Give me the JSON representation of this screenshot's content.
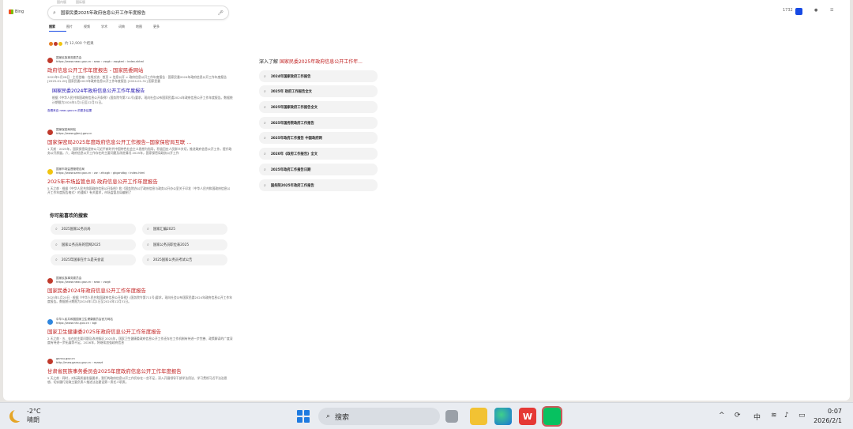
{
  "browser": {
    "top_tabs": [
      "国内版",
      "国际版"
    ],
    "logo_text": "Bing",
    "query": "国家民委2025年政府信息公开工作年度报告",
    "points": "1732",
    "tabs": [
      "搜索",
      "图片",
      "视频",
      "学术",
      "词典",
      "地图",
      "更多"
    ],
    "result_count": "约 12,900 个结果"
  },
  "results": [
    {
      "site_name": "国家民族事务委员会",
      "url": "https://www.neac.gov.cn › seac › zwgk › zwgkml › index.shtml",
      "title": "政府信息公开工作年度报告 - 国家民委网站",
      "snippet": "2022年1月28日 · 主任信箱 · 在线交流 · 首页 > 信息公开 > 政府信息公开工作年度报告 · 国家民委2024年政府信息公开工作年度报告 [2025-01-20] 国家民委2023年政府信息公开工作年度报告 [2024-01-31] 国家民委",
      "sub_title": "国家民委2024年政府信息公开工作年度报告",
      "sub_snippet": "根据《中华人民共和国政府信息公开条例》(国务院令第711号)要求，现向社会公布国家民委2024年政府信息公开工作年度报告。数据统计期限为2024年1月1日至12月31日。",
      "more": "查看来自 neac.gov.cn 的更多结果",
      "fav": "#c0392b"
    },
    {
      "site_name": "国家保密局网站",
      "url": "https://www.gjbmj.gov.cn",
      "title": "国家保密局2025年度政府信息公开工作报告--国家保密局互联 ...",
      "snippet": "1 天前 · 2025年，国家保密局坚持以习近平新时代中国特色社会主义思想为指导，积极回应人民群众关切，推进政府信息公开工作，提升政务公开质量。六、政府信息公开工作存在的主要问题及改进情况 2025年，国家保密局政务公开工作",
      "fav": "#c0392b"
    },
    {
      "site_name": "国家市场监督管理总局",
      "url": "https://www.samr.gov.cn › zw › zfxxgk › gkgzndbg › index.html",
      "title": "2025年市场监管总局 政府信息公开工作年度报告",
      "snippet": "5 天之前 · 根据《中华人民共和国政府信息公开条例》和《国务院办公厅政府信息与政务公开办公室关于印发〈中华人民共和国政府信息公开工作年度报告格式〉的通知》有关要求，市场监管总局编制了",
      "fav": "#f1c40f"
    }
  ],
  "also_search": {
    "heading": "你可能喜欢的搜索",
    "items": [
      "2025国家公务员局",
      "国家公务员局的官网2025",
      "2025年国家在什么是天会议",
      "国家汇编2025",
      "国家公务员职位表2025",
      "2025国家公务员考试公告"
    ]
  },
  "results2": [
    {
      "site_name": "国家民族事务委员会",
      "url": "https://www.neac.gov.cn › seac › zwgk",
      "title": "国家民委2024年政府信息公开工作年度报告",
      "snippet": "2025年1月20日 · 根据《中华人民共和国政府信息公开条例》(国务院令第711号)要求，现向社会公布国家民委2024年政府信息公开工作年度报告。数据统计期限为2024年1月1日至2024年12月31日。",
      "fav": "#c0392b"
    },
    {
      "site_name": "中华人民共和国国家卫生健康委员会官方网站",
      "url": "https://www.nhc.gov.cn › bgt",
      "title": "国家卫生健康委2025年政府信息公开工作年度报告",
      "snippet": "2 天之前 · 五、存在的主要问题及改进情况 2025年，国家卫生健康委政府信息公开工作还存在工作机制有待进一步完善、政策解读的广度深度有待进一步拓展等不足。2026年，将继续加强政府信息",
      "fav": "#2e86de"
    },
    {
      "site_name": "gansu.gov.cn",
      "url": "http://mzw.gansu.gov.cn › mzwzt",
      "title": "甘肃省民族事务委员会2025年度政府信息公开工作年度报告",
      "snippet": "5 天之前 · 同时，对标高质量发展要求，我们的政府信息公开工作仍存在一些不足，深入开展领导干部学法用法、学习贯彻习近平法治思想，切实履行党政主要负责人推进法治建设第一责任人职责。",
      "fav": "#c0392b"
    }
  ],
  "rail": {
    "heading_prefix": "深入了解",
    "heading_query": "国家民委2025年政府信息公开工作年...",
    "items": [
      "2024年国家政府工作报告",
      "2025年 政府工作报告全文",
      "2025年国家政府工作报告全文",
      "2025年国务院政府工作报告",
      "2025年政府工作报告 中国政府网",
      "2020年《政府工作报告》全文",
      "2025年政府工作报告日期",
      "国务院2025年政府工作报告"
    ]
  },
  "taskbar": {
    "temp": "-2°C",
    "weather": "晴朗",
    "search_label": "搜索",
    "ime": "中",
    "time": "0:07",
    "date": "2026/2/1"
  }
}
